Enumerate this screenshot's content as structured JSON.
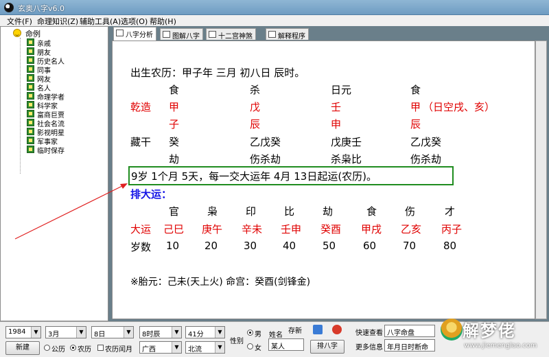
{
  "window": {
    "title": "玄奥八字v6.0"
  },
  "menu": [
    "文件(F)",
    "命理知识(Z)",
    "辅助工具(A)",
    "选项(O)",
    "帮助(H)"
  ],
  "tree": {
    "root": "命例",
    "items": [
      "亲戚",
      "朋友",
      "历史名人",
      "同事",
      "网友",
      "名人",
      "命理学者",
      "科学家",
      "富商巨贾",
      "社会名流",
      "影视明星",
      "军事家",
      "临时保存"
    ]
  },
  "tabs": [
    "八字分析",
    "图解八字",
    "十二宫神煞",
    "解释程序"
  ],
  "chart": {
    "birth_line": "出生农历：甲子年 三月 初八日 辰时。",
    "gods_top": [
      "食",
      "杀",
      "日元",
      "食"
    ],
    "qianzao_label": "乾造",
    "stems": [
      "甲",
      "戊",
      "壬",
      "甲"
    ],
    "stem_note": "（日空戌、亥）",
    "branches": [
      "子",
      "辰",
      "申",
      "辰"
    ],
    "canggan_label": "藏干",
    "canggan1": [
      "癸",
      "乙戊癸",
      "戊庚壬",
      "乙戊癸"
    ],
    "canggan2": [
      "劫",
      "伤杀劫",
      "杀枭比",
      "伤杀劫"
    ],
    "qiyun": "9岁 1个月 5天，每一交大运年 4月 13日起运(农历)。",
    "dayun_title": "排大运：",
    "dayun_gods": [
      "官",
      "枭",
      "印",
      "比",
      "劫",
      "食",
      "伤",
      "才"
    ],
    "dayun_label": "大运",
    "dayun": [
      "己巳",
      "庚午",
      "辛未",
      "壬申",
      "癸酉",
      "甲戌",
      "乙亥",
      "丙子"
    ],
    "age_label": "岁数",
    "ages": [
      "10",
      "20",
      "30",
      "40",
      "50",
      "60",
      "70",
      "80"
    ],
    "footer": "※胎元：己未(天上火)    命宫：癸酉(剑锋金)"
  },
  "bottom": {
    "year": "1984",
    "month": "3月",
    "day": "8日",
    "hour": "8时辰",
    "minute": "41分",
    "new_btn": "新建",
    "gongli": "公历",
    "nongli": "农历",
    "leap": "农历闰月",
    "province": "广西",
    "city": "北流",
    "gender_label": "性别",
    "male": "男",
    "female": "女",
    "name_label": "姓名",
    "name_value": "某人",
    "save_label": "存新",
    "paibazi_btn": "排八字",
    "quick_label": "快速查看",
    "quick_value": "八字命盘",
    "more_label": "更多信息",
    "more_value": "年月日时断命"
  },
  "brand": {
    "name": "解梦佬",
    "url": "www.jiemenglao.com"
  }
}
